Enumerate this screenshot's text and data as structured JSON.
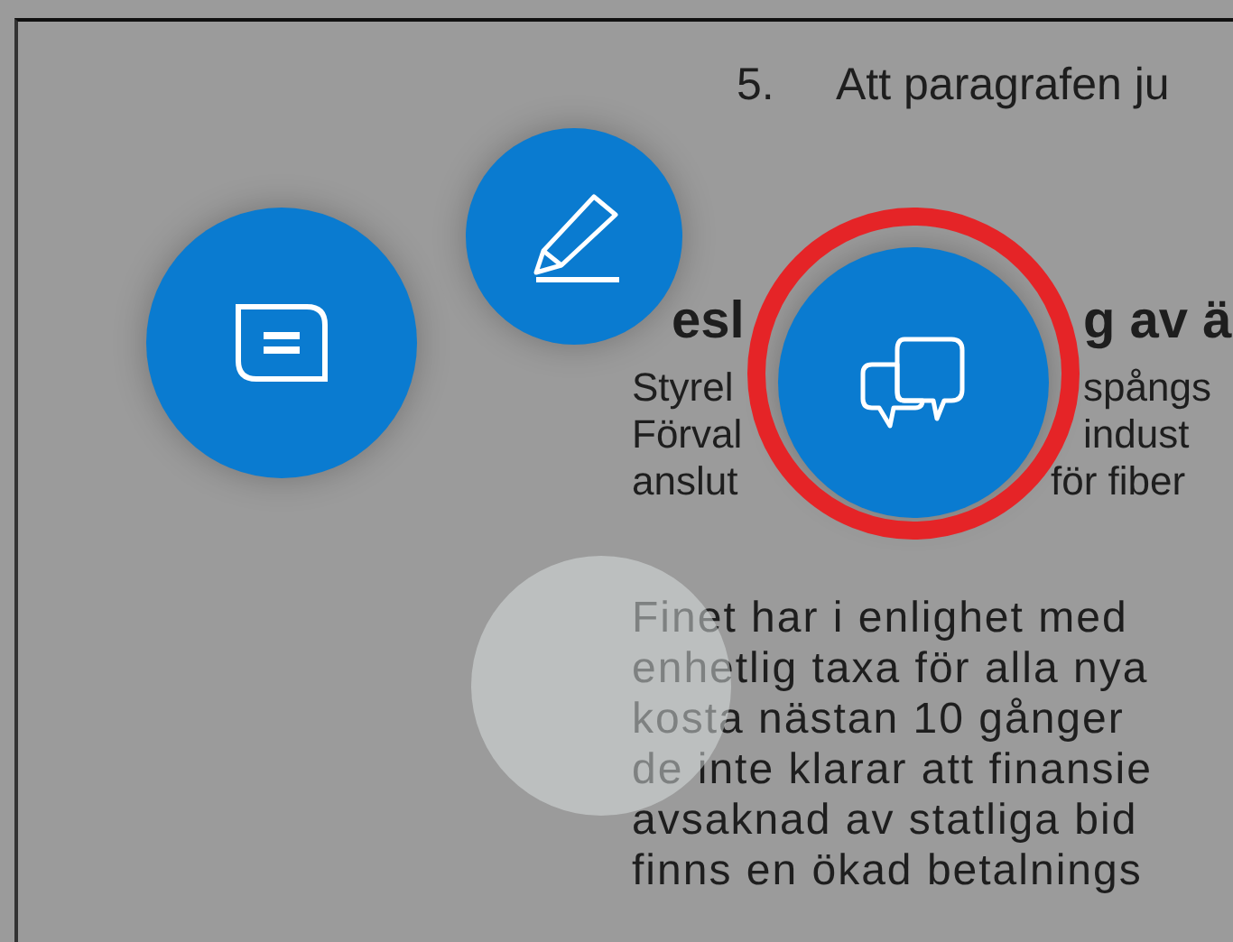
{
  "document": {
    "list_item": {
      "number": "5.",
      "text": "Att paragrafen ju"
    },
    "heading": [
      "esl",
      "g av ä"
    ],
    "intro_lines": [
      [
        "Styrel",
        "spångs"
      ],
      [
        "Förval",
        "indust"
      ],
      [
        "anslut",
        "för fiber"
      ]
    ],
    "paragraph_lines": [
      "Finet har i enlighet med",
      "enhetlig taxa för alla nya",
      "kosta nästan 10 gånger",
      "de inte klarar att finansie",
      "avsaknad av statliga bid",
      "finns en ökad betalnings"
    ]
  },
  "radial_menu": {
    "items": [
      {
        "kind": "note",
        "selected": false
      },
      {
        "kind": "pen",
        "selected": false
      },
      {
        "kind": "comments",
        "selected": true
      }
    ]
  }
}
